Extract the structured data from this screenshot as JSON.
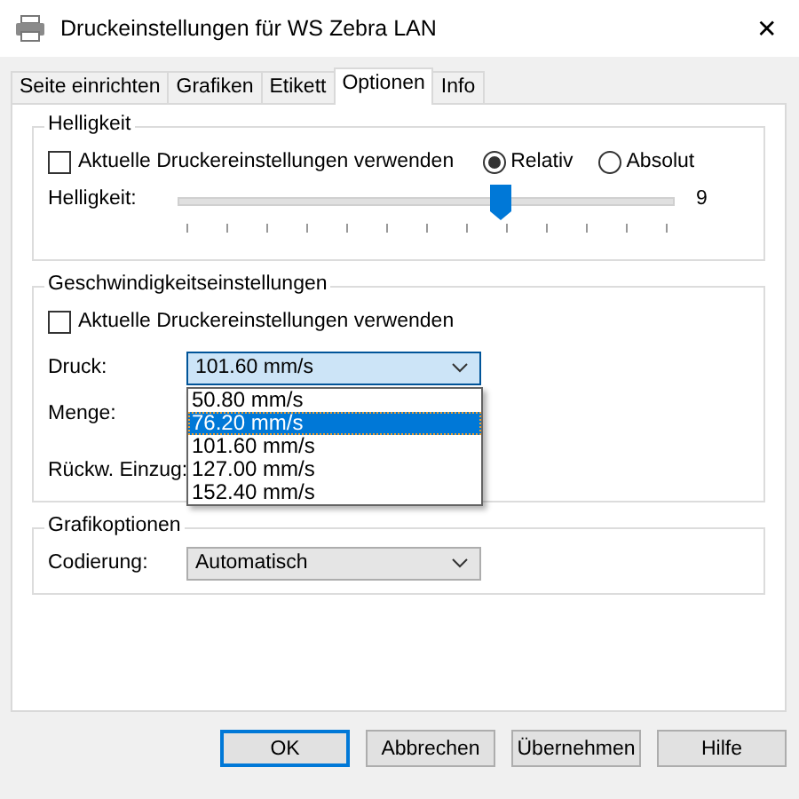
{
  "window": {
    "title": "Druckeinstellungen für WS Zebra LAN",
    "close": "✕"
  },
  "tabs": [
    {
      "label": "Seite einrichten",
      "selected": false
    },
    {
      "label": "Grafiken",
      "selected": false
    },
    {
      "label": "Etikett",
      "selected": false
    },
    {
      "label": "Optionen",
      "selected": true
    },
    {
      "label": "Info",
      "selected": false
    }
  ],
  "brightness": {
    "title": "Helligkeit",
    "use_printer_settings": {
      "label": "Aktuelle Druckereinstellungen verwenden",
      "checked": false
    },
    "modes": [
      {
        "label": "Relativ",
        "selected": true
      },
      {
        "label": "Absolut",
        "selected": false
      }
    ],
    "slider": {
      "label": "Helligkeit:",
      "level": 0.65,
      "reading": "9"
    }
  },
  "speed": {
    "title": "Geschwindigkeitseinstellungen",
    "use_printer_settings": {
      "label": "Aktuelle Druckereinstellungen verwenden",
      "checked": false
    },
    "print": {
      "label": "Druck:",
      "value": "101.60 mm/s",
      "options": [
        {
          "label": "50.80 mm/s",
          "highlighted": false
        },
        {
          "label": "76.20 mm/s",
          "highlighted": true
        },
        {
          "label": "101.60 mm/s",
          "highlighted": false
        },
        {
          "label": "127.00 mm/s",
          "highlighted": false
        },
        {
          "label": "152.40 mm/s",
          "highlighted": false
        }
      ]
    },
    "amount": {
      "label": "Menge:"
    },
    "backfeed": {
      "label": "Rückw. Einzug:"
    }
  },
  "graphics": {
    "title": "Grafikoptionen",
    "encoding": {
      "label": "Codierung:",
      "value": "Automatisch"
    }
  },
  "buttons": [
    "OK",
    "Abbrechen",
    "Übernehmen",
    "Hilfe"
  ]
}
